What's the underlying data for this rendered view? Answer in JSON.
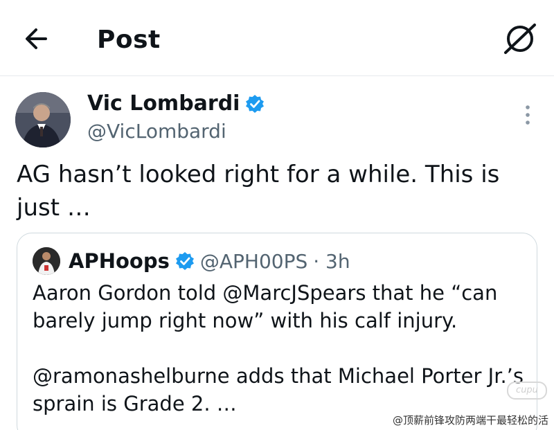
{
  "header": {
    "title": "Post"
  },
  "post": {
    "author_name": "Vic Lombardi",
    "author_handle": "@VicLombardi",
    "text_line1": "AG hasn’t looked right for a while. This is",
    "text_line2": "just …"
  },
  "quote": {
    "name": "APHoops",
    "handle": "@APH00PS",
    "time": "· 3h",
    "para1": "Aaron Gordon told @MarcJSpears that he “can barely jump right now” with his calf injury.",
    "para2": "@ramonashelburne adds that Michael Porter Jr.’s sprain is Grade 2. …"
  },
  "watermark": {
    "text": "@顶薪前锋攻防两端干最轻松的活",
    "badge": "cupu"
  },
  "colors": {
    "verified": "#1d9bf0",
    "secondary_text": "#536471",
    "border": "#cfd9de"
  },
  "icons": [
    "back-arrow-icon",
    "grok-icon",
    "verified-badge-icon",
    "more-vertical-icon"
  ]
}
